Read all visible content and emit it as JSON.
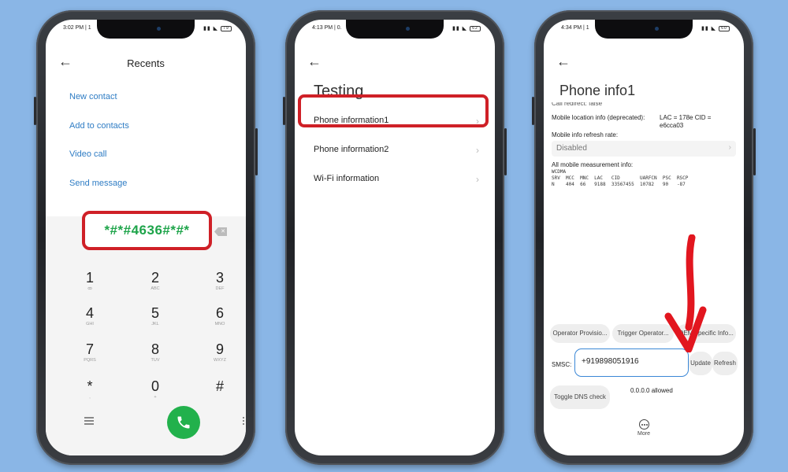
{
  "phone1": {
    "status_time": "3:02 PM | 1",
    "battery": "79",
    "title": "Recents",
    "links": [
      "New contact",
      "Add to contacts",
      "Video call",
      "Send message"
    ],
    "dialed": "*#*#4636#*#*",
    "keys": [
      {
        "n": "1",
        "l": "ꝏ"
      },
      {
        "n": "2",
        "l": "ABC"
      },
      {
        "n": "3",
        "l": "DEF"
      },
      {
        "n": "4",
        "l": "GHI"
      },
      {
        "n": "5",
        "l": "JKL"
      },
      {
        "n": "6",
        "l": "MNO"
      },
      {
        "n": "7",
        "l": "PQRS"
      },
      {
        "n": "8",
        "l": "TUV"
      },
      {
        "n": "9",
        "l": "WXYZ"
      },
      {
        "n": "*",
        "l": ","
      },
      {
        "n": "0",
        "l": "+"
      },
      {
        "n": "#",
        "l": ""
      }
    ],
    "icons": {
      "menu": "menu-icon",
      "call": "phone-icon",
      "keypad": "dialpad-icon",
      "back": "back-arrow-icon"
    },
    "accent": "#22b14c"
  },
  "phone2": {
    "status_time": "4:13 PM | 0.",
    "battery": "62",
    "title": "Testing",
    "items": [
      "Phone information1",
      "Phone information2",
      "Wi-Fi information"
    ]
  },
  "phone3": {
    "status_time": "4:34 PM | 1",
    "battery": "60",
    "title": "Phone info1",
    "clipped_line": "Call redirect: false",
    "loc_label": "Mobile location info (deprecated):",
    "loc_value": "LAC = 178e   CID =",
    "loc_value2": "e6cca03",
    "refresh_label": "Mobile info refresh rate:",
    "refresh_value": "Disabled",
    "meas_label": "All mobile measurement info:",
    "meas_lines": [
      "WCDMA",
      "SRV  MCC  MNC  LAC   CID       UARFCN  PSC  RSCP",
      "N    404  66   9188  33567455  10782   90   -87"
    ],
    "buttons": {
      "operator_prov": "Operator Provisio...",
      "trigger_operator": "Trigger Operator...",
      "oem": "OEM-specific Info...",
      "update": "Update",
      "refresh": "Refresh",
      "dns": "Toggle DNS check"
    },
    "smsc_label": "SMSC:",
    "smsc_value": "+919898051916",
    "dns_value": "0.0.0.0 allowed",
    "more_label": "More"
  },
  "highlight_color": "#cf2027"
}
